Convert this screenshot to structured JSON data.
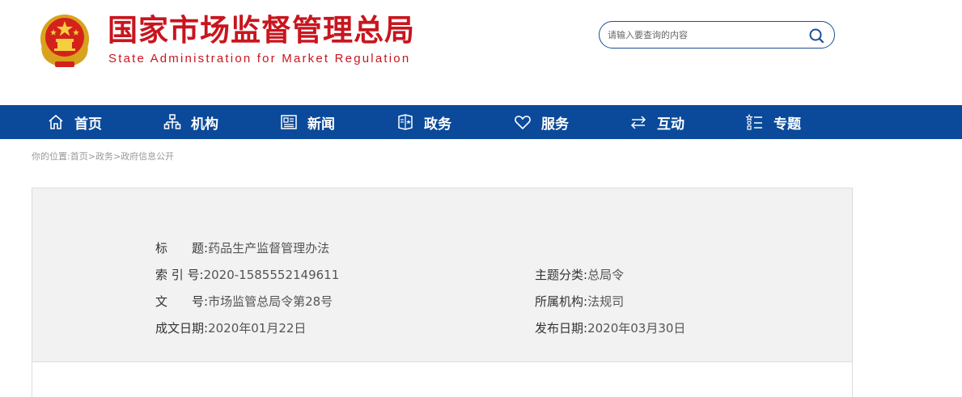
{
  "header": {
    "title": "国家市场监督管理总局",
    "subtitle": "State Administration for Market Regulation"
  },
  "search": {
    "placeholder": "请输入要查询的内容",
    "icon": "search-icon"
  },
  "nav": {
    "items": [
      {
        "label": "首页",
        "icon": "home-icon"
      },
      {
        "label": "机构",
        "icon": "org-chart-icon"
      },
      {
        "label": "新闻",
        "icon": "news-icon"
      },
      {
        "label": "政务",
        "icon": "government-icon"
      },
      {
        "label": "服务",
        "icon": "heart-icon"
      },
      {
        "label": "互动",
        "icon": "exchange-arrows-icon"
      },
      {
        "label": "专题",
        "icon": "topic-list-icon"
      }
    ]
  },
  "breadcrumb": {
    "prefix": "你的位置:",
    "items": [
      "首页",
      "政务",
      "政府信息公开"
    ],
    "separator": ">"
  },
  "info": {
    "title_label": "标　　题:",
    "title_value": "药品生产监督管理办法",
    "index_label": "索 引 号:",
    "index_value": "2020-1585552149611",
    "category_label": "主题分类:",
    "category_value": "总局令",
    "doc_no_label": "文　　号:",
    "doc_no_value": "市场监管总局令第28号",
    "org_label": "所属机构:",
    "org_value": "法规司",
    "created_label": "成文日期:",
    "created_value": "2020年01月22日",
    "published_label": "发布日期:",
    "published_value": "2020年03月30日"
  },
  "colors": {
    "brand_red": "#c9151e",
    "nav_blue": "#0b4a9a",
    "panel_bg": "#f2f2f2"
  }
}
